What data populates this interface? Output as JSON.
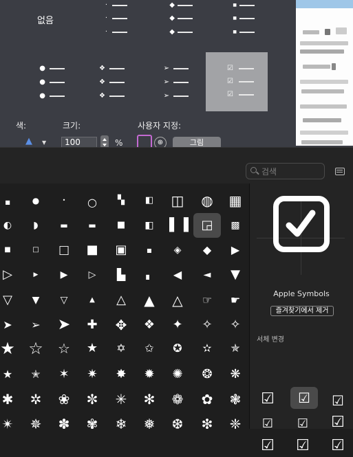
{
  "bullets": {
    "none_label": "없음",
    "color_label": "색:",
    "size_label": "크기:",
    "size_value": "100",
    "size_unit": "%",
    "custom_label": "사용자 지정:",
    "picture_button": "그림"
  },
  "viewer": {
    "search_placeholder": "검색",
    "font_name": "Apple Symbols",
    "remove_favorite": "즐겨찾기에서 제거",
    "variants_label": "서체 변경"
  }
}
